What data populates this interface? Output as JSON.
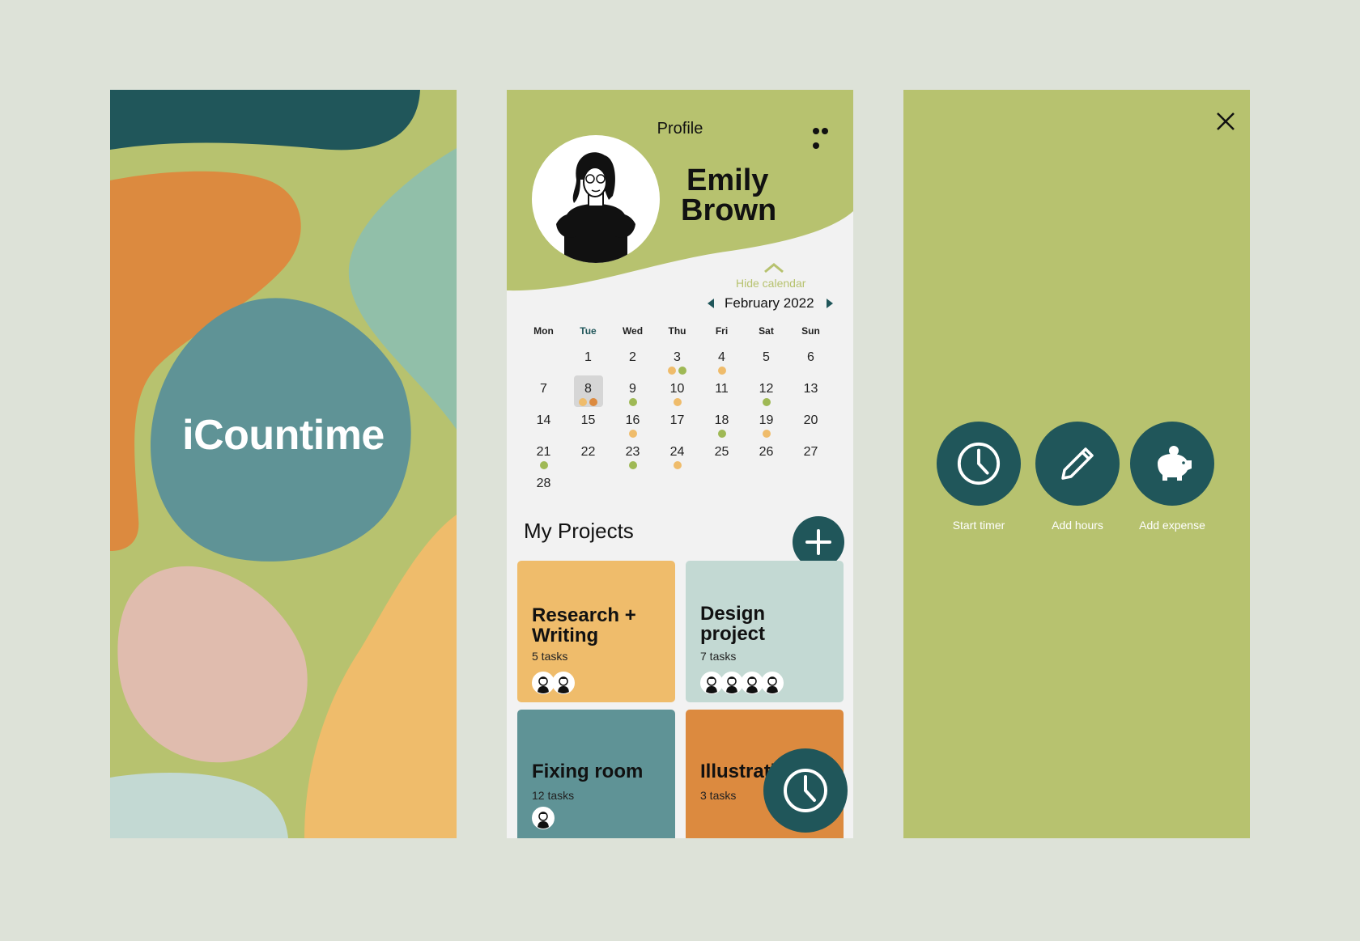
{
  "splash": {
    "app_title": "iCountime"
  },
  "profile": {
    "header_title": "Profile",
    "user_first_name": "Emily",
    "user_last_name": "Brown",
    "hide_calendar_label": "Hide calendar",
    "month_label": "February 2022",
    "weekdays": [
      "Mon",
      "Tue",
      "Wed",
      "Thu",
      "Fri",
      "Sat",
      "Sun"
    ],
    "today_weekday": "Tue",
    "selected_day": 8,
    "calendar_weeks": [
      [
        null,
        {
          "d": 1
        },
        {
          "d": 2
        },
        {
          "d": 3,
          "dots": [
            "orange",
            "green"
          ]
        },
        {
          "d": 4,
          "dots": [
            "orange"
          ]
        },
        {
          "d": 5
        },
        {
          "d": 6
        }
      ],
      [
        {
          "d": 7
        },
        {
          "d": 8,
          "dots": [
            "orange",
            "darkorange"
          ]
        },
        {
          "d": 9,
          "dots": [
            "green"
          ]
        },
        {
          "d": 10,
          "dots": [
            "orange"
          ]
        },
        {
          "d": 11
        },
        {
          "d": 12,
          "dots": [
            "green"
          ]
        },
        {
          "d": 13
        }
      ],
      [
        {
          "d": 14
        },
        {
          "d": 15
        },
        {
          "d": 16,
          "dots": [
            "orange"
          ]
        },
        {
          "d": 17
        },
        {
          "d": 18,
          "dots": [
            "green"
          ]
        },
        {
          "d": 19,
          "dots": [
            "orange"
          ]
        },
        {
          "d": 20
        }
      ],
      [
        {
          "d": 21,
          "dots": [
            "green"
          ]
        },
        {
          "d": 22
        },
        {
          "d": 23,
          "dots": [
            "green"
          ]
        },
        {
          "d": 24,
          "dots": [
            "orange"
          ]
        },
        {
          "d": 25
        },
        {
          "d": 26
        },
        {
          "d": 27
        }
      ],
      [
        {
          "d": 28
        },
        null,
        null,
        null,
        null,
        null,
        null
      ]
    ],
    "projects_title": "My Projects",
    "projects": [
      {
        "title_line1": "Research +",
        "title_line2": "Writing",
        "tasks": "5 tasks",
        "color": "#efbc6b",
        "members": 2
      },
      {
        "title_line1": "Design",
        "title_line2": "project",
        "tasks": "7 tasks",
        "color": "#c3d9d3",
        "members": 4
      },
      {
        "title_line1": "Fixing room",
        "title_line2": "",
        "tasks": "12 tasks",
        "color": "#5f9396",
        "members": 1
      },
      {
        "title_line1": "Illustration",
        "title_line2": "",
        "tasks": "3 tasks",
        "color": "#dc8a3f",
        "members": 0
      }
    ]
  },
  "actions": {
    "start_timer": "Start timer",
    "add_hours": "Add hours",
    "add_expense": "Add expense"
  },
  "colors": {
    "background": "#dde2d8",
    "olive": "#b7c26f",
    "dark_teal": "#20565a",
    "orange": "#efbc6b",
    "darkorange": "#dc8a3f",
    "green": "#9fb955",
    "blob_orange": "#dc8a3f",
    "blob_teal": "#5f9396",
    "blob_mint": "#91bfa9",
    "blob_pink": "#e0bcae",
    "blob_yellow": "#efbc6b",
    "blob_light": "#c3d9d3"
  }
}
